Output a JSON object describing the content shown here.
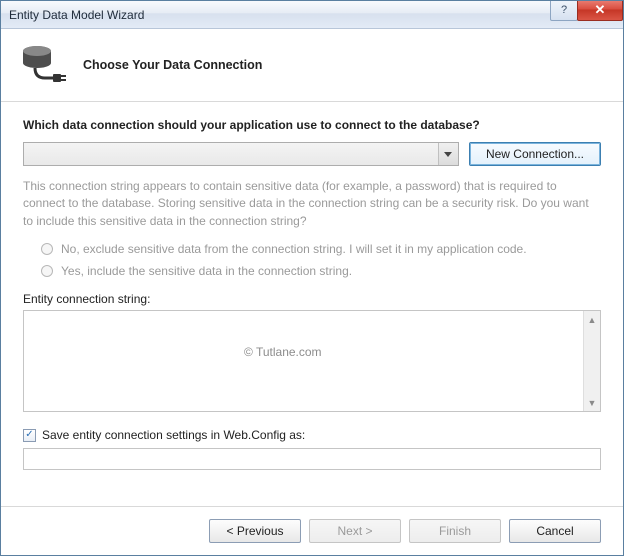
{
  "title": "Entity Data Model Wizard",
  "header": {
    "heading": "Choose Your Data Connection"
  },
  "body": {
    "prompt": "Which data connection should your application use to connect to the database?",
    "connection_value": "",
    "new_connection_label": "New Connection...",
    "sensitive_info": "This connection string appears to contain sensitive data (for example, a password) that is required to connect to the database. Storing sensitive data in the connection string can be a security risk. Do you want to include this sensitive data in the connection string?",
    "radio_exclude": "No, exclude sensitive data from the connection string. I will set it in my application code.",
    "radio_include": "Yes, include the sensitive data in the connection string.",
    "entity_label": "Entity connection string:",
    "entity_value": "",
    "watermark": "© Tutlane.com",
    "save_checkbox_label": "Save entity connection settings in Web.Config as:",
    "save_checkbox_checked": true,
    "save_name_value": ""
  },
  "footer": {
    "previous": "< Previous",
    "next": "Next >",
    "finish": "Finish",
    "cancel": "Cancel"
  }
}
